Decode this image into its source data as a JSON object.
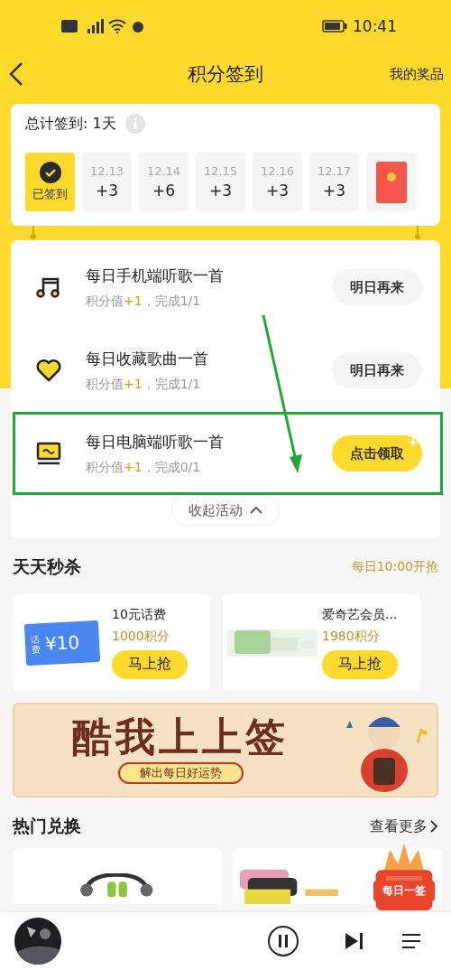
{
  "status_bar": {
    "time": "10:41"
  },
  "header": {
    "title": "积分签到",
    "action": "我的奖品"
  },
  "checkin": {
    "total": "总计签到: 1天",
    "days": [
      {
        "kind": "day",
        "checked": true,
        "label": "已签到"
      },
      {
        "kind": "day",
        "checked": false,
        "date": "12.13",
        "points": "+3"
      },
      {
        "kind": "day",
        "checked": false,
        "date": "12.14",
        "points": "+6"
      },
      {
        "kind": "day",
        "checked": false,
        "date": "12.15",
        "points": "+3"
      },
      {
        "kind": "day",
        "checked": false,
        "date": "12.16",
        "points": "+3"
      },
      {
        "kind": "day",
        "checked": false,
        "date": "12.17",
        "points": "+3"
      },
      {
        "kind": "gift"
      }
    ]
  },
  "tasks": [
    {
      "kind": "music",
      "title": "每日手机端听歌一首",
      "detail": "积分值**+1**，完成1/1",
      "button": "明日再来",
      "enabled": false,
      "highlighted": false
    },
    {
      "kind": "heart",
      "title": "每日收藏歌曲一首",
      "detail": "积分值**+1**，完成1/1",
      "button": "明日再来",
      "enabled": false,
      "highlighted": false
    },
    {
      "kind": "screen",
      "title": "每日电脑端听歌一首",
      "detail": "积分值**+1**，完成0/1",
      "button": "点击领取",
      "enabled": true,
      "highlighted": true
    }
  ],
  "collapse": "收起活动",
  "flash_sale": {
    "title": "天天秒杀",
    "note": "每日10:00开抢",
    "items": [
      {
        "kind": "voucher",
        "voucher_label": "话费",
        "voucher_value": "¥10",
        "name": "10元话费",
        "price": "1000积分",
        "button": "马上抢"
      },
      {
        "kind": "picture",
        "name": "爱奇艺会员...",
        "price": "1980积分",
        "button": "马上抢"
      }
    ]
  },
  "banner": {
    "title": "酷我上上签",
    "subtitle": "解出每日好运势"
  },
  "hot": {
    "title": "热门兑换",
    "more": "查看更多"
  },
  "float_badge": "每日一签"
}
